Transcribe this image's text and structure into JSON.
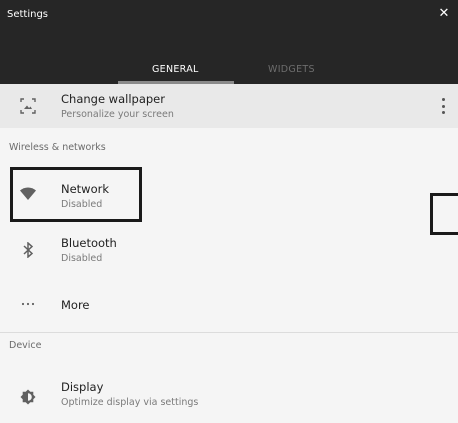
{
  "window": {
    "title": "Settings",
    "close_icon": "close-icon"
  },
  "tabs": [
    {
      "label": "GENERAL",
      "active": true
    },
    {
      "label": "WIDGETS",
      "active": false
    }
  ],
  "wallpaper": {
    "title": "Change wallpaper",
    "subtitle": "Personalize your screen",
    "icon": "wallpaper-icon",
    "menu_icon": "more-vert-icon"
  },
  "sections": {
    "wireless": {
      "header": "Wireless & networks",
      "items": [
        {
          "title": "Network",
          "subtitle": "Disabled",
          "icon": "wifi-icon"
        },
        {
          "title": "Bluetooth",
          "subtitle": "Disabled",
          "icon": "bluetooth-icon"
        },
        {
          "title": "More",
          "icon": "more-horiz-icon"
        }
      ]
    },
    "device": {
      "header": "Device",
      "items": [
        {
          "title": "Display",
          "subtitle": "Optimize display via settings",
          "icon": "brightness-icon"
        }
      ]
    }
  },
  "colors": {
    "header_bg": "#262626",
    "content_bg": "#f5f5f5",
    "highlight_border": "#1a1a1a"
  }
}
